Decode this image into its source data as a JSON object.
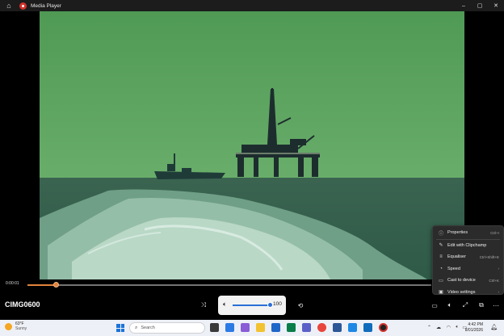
{
  "window": {
    "title": "Media Player",
    "controls": {
      "minimize": "–",
      "maximize": "▢",
      "close": "✕"
    }
  },
  "player": {
    "time_elapsed": "0:00:01",
    "seek_fraction": 0.07,
    "video_title": "CIMG0600",
    "volume": {
      "value": "100",
      "fraction": 1.0
    }
  },
  "context_menu": {
    "items": [
      {
        "icon": "info-icon",
        "label": "Properties",
        "shortcut": "Ctrl+I"
      },
      {
        "icon": "clipchamp-icon",
        "label": "Edit with Clipchamp",
        "shortcut": ""
      },
      {
        "icon": "equaliser-icon",
        "label": "Equaliser",
        "shortcut": "Ctrl+Shift+E"
      },
      {
        "icon": "speed-icon",
        "label": "Speed",
        "shortcut": "›"
      },
      {
        "icon": "cast-icon",
        "label": "Cast to device",
        "shortcut": "Ctrl+K"
      },
      {
        "icon": "video-settings-icon",
        "label": "Video settings",
        "shortcut": "›"
      }
    ]
  },
  "taskbar": {
    "weather_temp": "63°F",
    "weather_desc": "Sunny",
    "search_placeholder": "Search",
    "time": "4:42 PM",
    "date": "8/01/2026"
  },
  "colors": {
    "accent_orange": "#e1843c",
    "volume_blue": "#2a6fd6",
    "water_green": "#3f6a4e"
  }
}
